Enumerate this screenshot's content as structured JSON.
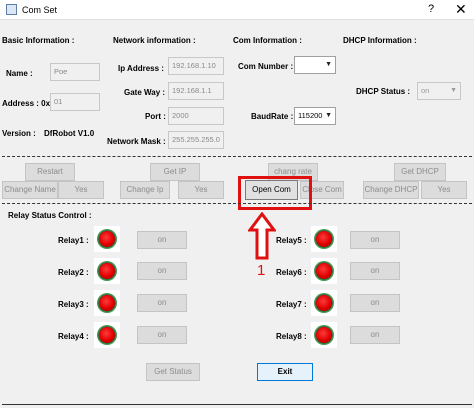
{
  "window": {
    "title": "Com Set",
    "help": "?",
    "close": "✕"
  },
  "sections": {
    "basic": "Basic Information :",
    "network": "Network information :",
    "com": "Com Information :",
    "dhcp": "DHCP Information :",
    "relay": "Relay Status Control :"
  },
  "basic": {
    "name_label": "Name :",
    "name_value": "Poe",
    "address_label": "Address : 0x",
    "address_value": "01",
    "version_label": "Version :",
    "version_value": "DfRobot V1.0"
  },
  "network": {
    "ip_label": "Ip Address :",
    "ip_value": "192.168.1.10",
    "gateway_label": "Gate Way :",
    "gateway_value": "192.168.1.1",
    "port_label": "Port :",
    "port_value": "2000",
    "mask_label": "Network Mask :",
    "mask_value": "255.255.255.0"
  },
  "com": {
    "number_label": "Com Number :",
    "number_value": "",
    "baud_label": "BaudRate :",
    "baud_value": "115200"
  },
  "dhcp": {
    "status_label": "DHCP Status :",
    "status_value": "on"
  },
  "buttons": {
    "restart": "Restart",
    "change_name": "Change Name",
    "yes1": "Yes",
    "get_ip": "Get IP",
    "change_ip": "Change Ip",
    "yes2": "Yes",
    "change_rate": "chang rate",
    "open_com": "Open Com",
    "close_com": "Close Com",
    "get_dhcp": "Get DHCP",
    "change_dhcp": "Change DHCP",
    "yes3": "Yes",
    "get_status": "Get Status",
    "exit": "Exit"
  },
  "relays": [
    {
      "label": "Relay1 :",
      "button": "on"
    },
    {
      "label": "Relay2 :",
      "button": "on"
    },
    {
      "label": "Relay3 :",
      "button": "on"
    },
    {
      "label": "Relay4 :",
      "button": "on"
    },
    {
      "label": "Relay5 :",
      "button": "on"
    },
    {
      "label": "Relay6 :",
      "button": "on"
    },
    {
      "label": "Relay7 :",
      "button": "on"
    },
    {
      "label": "Relay8 :",
      "button": "on"
    }
  ],
  "annotation": {
    "step": "1",
    "color": "#e01010"
  },
  "colors": {
    "led_on": "#e00000",
    "annotation": "#e01010"
  },
  "icons": {
    "app": "window-icon",
    "arrow": "up-arrow-icon",
    "combo": "chevron-down-icon"
  }
}
